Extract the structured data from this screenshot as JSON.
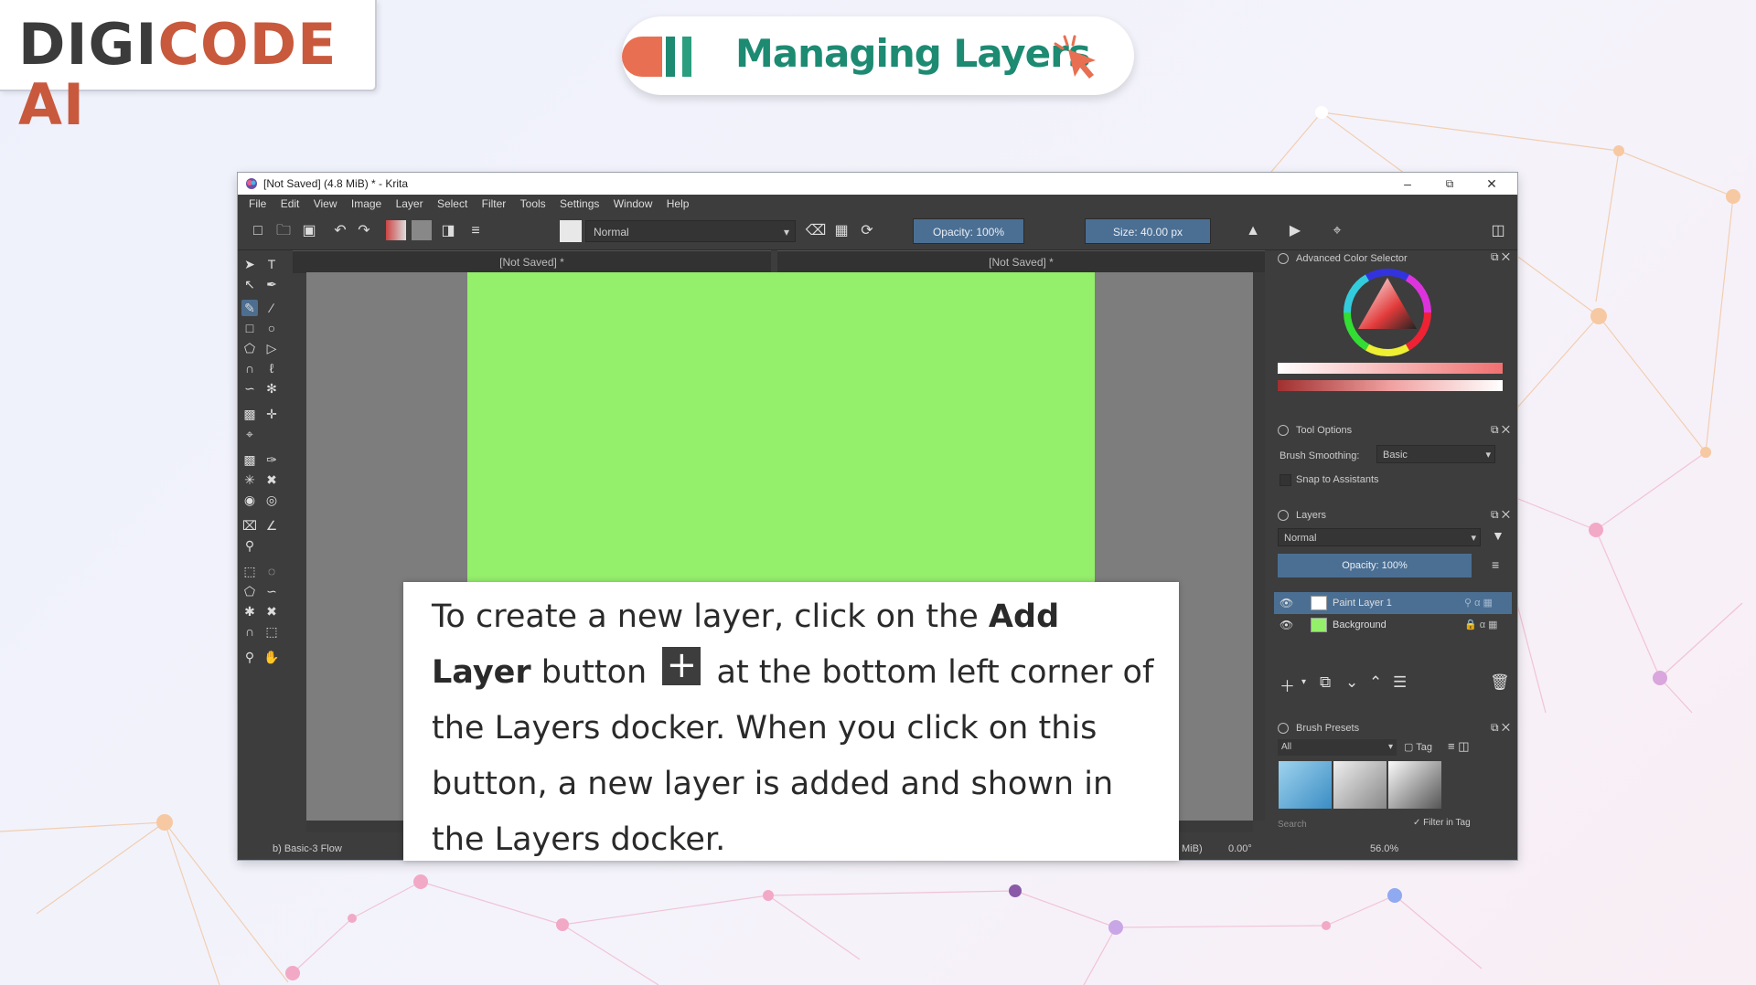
{
  "logo": {
    "part1": "DIGI",
    "part2": "CODE AI"
  },
  "header": {
    "title": "Managing Layers"
  },
  "krita": {
    "window_title": "[Not Saved]  (4.8 MiB)  * - Krita",
    "menu": [
      "File",
      "Edit",
      "View",
      "Image",
      "Layer",
      "Select",
      "Filter",
      "Tools",
      "Settings",
      "Window",
      "Help"
    ],
    "blend_mode": "Normal",
    "opacity": "Opacity: 100%",
    "size": "Size: 40.00 px",
    "tabs": [
      {
        "label": "[Not Saved]  *"
      },
      {
        "label": "[Not Saved]  *"
      }
    ],
    "status_left": "b) Basic-3 Flow",
    "status_mid": "MiB)",
    "status_rotation": "0.00°",
    "status_zoom": "56.0%",
    "color_selector": {
      "title": "Advanced Color Selector"
    },
    "tool_options": {
      "title": "Tool Options",
      "smoothing_label": "Brush Smoothing:",
      "smoothing_value": "Basic",
      "snap_label": "Snap to Assistants"
    },
    "layers": {
      "title": "Layers",
      "blend_mode": "Normal",
      "opacity": "Opacity:  100%",
      "items": [
        {
          "name": "Paint Layer 1",
          "selected": true
        },
        {
          "name": "Background",
          "selected": false
        }
      ]
    },
    "brush_presets": {
      "title": "Brush Presets",
      "filter_value": "All",
      "tag_label": "Tag",
      "search_placeholder": "Search",
      "filter_in_tag": "Filter in Tag"
    }
  },
  "caption": {
    "part1": "To create a new layer, click on the ",
    "bold1": "Add",
    "bold2": "Layer",
    "part2": " button ",
    "part3": " at the bottom left corner of the Layers docker. When you click on this button, a new layer is added and shown in the Layers docker."
  },
  "colors": {
    "accent_orange": "#e86f52",
    "title_green": "#1d8a72",
    "canvas_green": "#94ef6b",
    "krita_selection": "#4b6f93"
  }
}
